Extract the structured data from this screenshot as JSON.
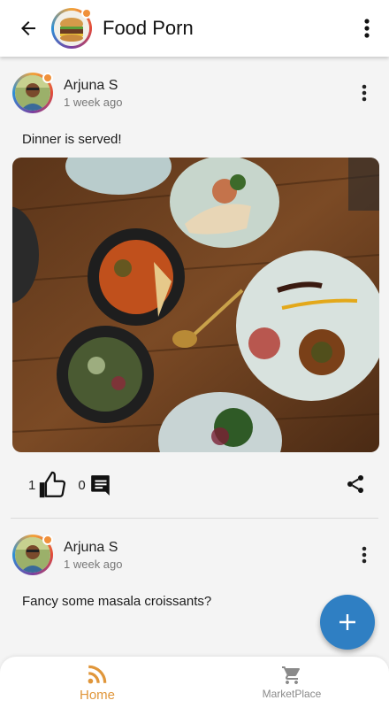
{
  "appbar": {
    "title": "Food Porn",
    "back_icon": "arrow-left-icon",
    "more_icon": "more-vertical-icon"
  },
  "posts": [
    {
      "author": "Arjuna S",
      "time": "1 week ago",
      "text": "Dinner is served!",
      "has_image": true,
      "likes": "1",
      "comments": "0"
    },
    {
      "author": "Arjuna S",
      "time": "1 week ago",
      "text": "Fancy some masala croissants?"
    }
  ],
  "fab": {
    "icon": "plus-icon"
  },
  "bottom_nav": {
    "items": [
      {
        "label": "Home",
        "icon": "rss-icon",
        "active": true
      },
      {
        "label": "MarketPlace",
        "icon": "cart-icon",
        "active": false
      }
    ]
  },
  "colors": {
    "accent": "#e0963a",
    "fab": "#2f7fc3",
    "avatar_dot": "#f0903a"
  }
}
